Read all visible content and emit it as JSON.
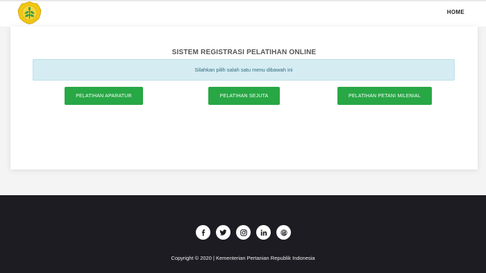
{
  "header": {
    "logo_icon": "ministry-emblem-icon",
    "nav_home": "HOME"
  },
  "main": {
    "title": "SISTEM REGISTRASI PELATIHAN ONLINE",
    "alert_text": "Silahkan pilih salah satu menu dibawah ini",
    "buttons": [
      {
        "label": "PELATIHAN APARATUR"
      },
      {
        "label": "PELATIHAN SEJUTA"
      },
      {
        "label": "PELATIHAN PETANI MILENIAL"
      }
    ]
  },
  "footer": {
    "socials": [
      "facebook-icon",
      "twitter-icon",
      "instagram-icon",
      "linkedin-icon",
      "threads-icon"
    ],
    "copyright": "Copyright © 2020 | Kementerian Pertanian Republik Indonesia"
  },
  "colors": {
    "accent_green": "#28a745",
    "footer_bg": "#1d1c22",
    "alert_bg": "#d4ecf2"
  }
}
